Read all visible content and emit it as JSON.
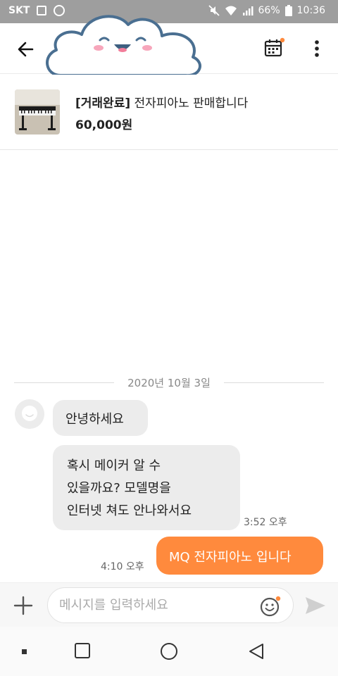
{
  "status_bar": {
    "carrier": "SKT",
    "battery": "66%",
    "time": "10:36"
  },
  "product": {
    "status_tag": "[거래완료]",
    "title": "전자피아노 판매합니다",
    "price": "60,000원"
  },
  "chat": {
    "date": "2020년 10월 3일",
    "messages": [
      {
        "sender": "other",
        "text": "안녕하세요"
      },
      {
        "sender": "other",
        "lines": [
          "혹시 메이커 알 수",
          "있을까요? 모델명을",
          "인터넷 쳐도 안나와서요"
        ],
        "time": "3:52 오후"
      },
      {
        "sender": "me",
        "text": "MQ 전자피아노 입니다",
        "time": "4:10 오후"
      }
    ]
  },
  "input": {
    "placeholder": "메시지를 입력하세요"
  },
  "colors": {
    "accent": "#ff8a3d",
    "status_bar": "#9e9e9e",
    "incoming_bubble": "#ececec",
    "mascot_outline": "#4a6f91"
  },
  "icons": {
    "back": "arrow-left-icon",
    "calendar": "calendar-icon",
    "more": "more-vertical-icon",
    "plus": "plus-icon",
    "emoji": "smile-icon",
    "send": "send-icon"
  }
}
